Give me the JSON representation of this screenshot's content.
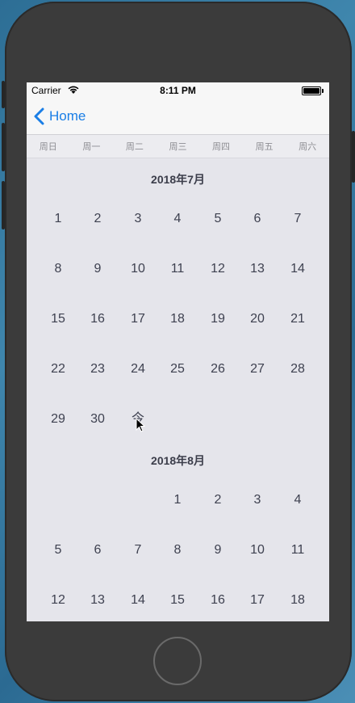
{
  "status_bar": {
    "carrier": "Carrier",
    "time": "8:11 PM"
  },
  "nav": {
    "back_label": "Home"
  },
  "weekdays": [
    "周日",
    "周一",
    "周二",
    "周三",
    "周四",
    "周五",
    "周六"
  ],
  "months": [
    {
      "title": "2018年7月",
      "rows": [
        [
          "1",
          "2",
          "3",
          "4",
          "5",
          "6",
          "7"
        ],
        [
          "8",
          "9",
          "10",
          "11",
          "12",
          "13",
          "14"
        ],
        [
          "15",
          "16",
          "17",
          "18",
          "19",
          "20",
          "21"
        ],
        [
          "22",
          "23",
          "24",
          "25",
          "26",
          "27",
          "28"
        ],
        [
          "29",
          "30",
          "今",
          "",
          "",
          "",
          ""
        ]
      ]
    },
    {
      "title": "2018年8月",
      "rows": [
        [
          "",
          "",
          "",
          "1",
          "2",
          "3",
          "4"
        ],
        [
          "5",
          "6",
          "7",
          "8",
          "9",
          "10",
          "11"
        ],
        [
          "12",
          "13",
          "14",
          "15",
          "16",
          "17",
          "18"
        ]
      ]
    }
  ],
  "colors": {
    "accent": "#1a7ee6",
    "day_text": "#3e4150",
    "background": "#e5e5eb"
  }
}
